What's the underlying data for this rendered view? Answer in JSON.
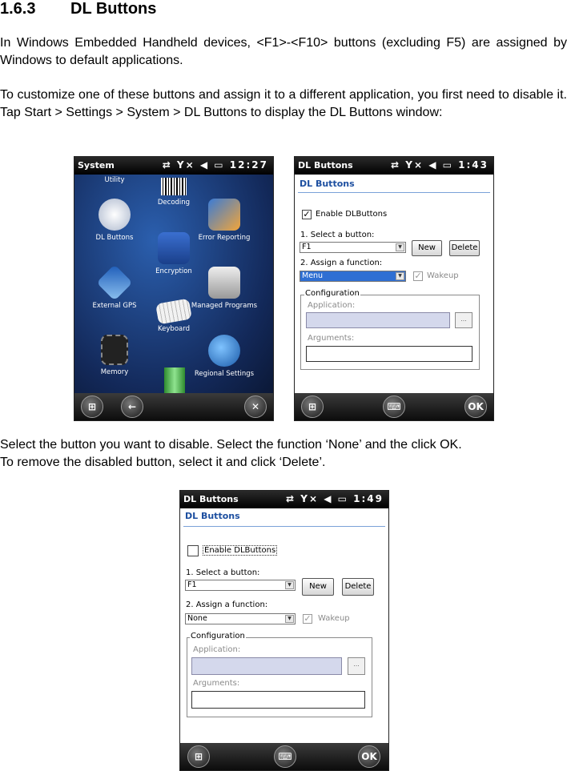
{
  "section": {
    "number": "1.6.3",
    "title": "DL Buttons"
  },
  "paragraphs": {
    "p1": "In Windows Embedded Handheld devices, <F1>-<F10> buttons (excluding F5) are assigned by Windows to default applications.",
    "p2": "To customize one of these buttons and assign it to a different application, you first need to disable it. Tap Start > Settings > System > DL Buttons to display the DL Buttons window:",
    "p3_line1": "Select the button you want to disable. Select the function ‘None’ and the click OK.",
    "p3_line2": "To remove the disabled button, select it and click ‘Delete’."
  },
  "screen_system": {
    "title": "System",
    "time": "12:27",
    "items": [
      "Utility",
      "Decoding",
      "DL Buttons",
      "Error Reporting",
      "Encryption",
      "External GPS",
      "Managed Programs",
      "Keyboard",
      "Memory",
      "Regional Settings"
    ]
  },
  "screen_dl_1": {
    "title": "DL Buttons",
    "time": "1:43",
    "heading": "DL Buttons",
    "enable_label": "Enable DLButtons",
    "enable_checked": true,
    "select_button_label": "1. Select a button:",
    "select_button_value": "F1",
    "new_label": "New",
    "delete_label": "Delete",
    "assign_label": "2. Assign a function:",
    "assign_value": "Menu",
    "wakeup_label": "Wakeup",
    "config_label": "Configuration",
    "application_label": "Application:",
    "ellipsis": "...",
    "arguments_label": "Arguments:"
  },
  "screen_dl_2": {
    "title": "DL Buttons",
    "time": "1:49",
    "heading": "DL Buttons",
    "enable_label": "Enable DLButtons",
    "enable_checked": false,
    "select_button_label": "1. Select a button:",
    "select_button_value": "F1",
    "new_label": "New",
    "delete_label": "Delete",
    "assign_label": "2. Assign a function:",
    "assign_value": "None",
    "wakeup_label": "Wakeup",
    "config_label": "Configuration",
    "application_label": "Application:",
    "ellipsis": "...",
    "arguments_label": "Arguments:",
    "ok_label": "OK"
  },
  "softkeys": {
    "ok": "OK"
  },
  "status_icons": "⇄ Y⨯ ◀ ▭",
  "colors": {
    "accent": "#1d4fa0",
    "highlight": "#2f6fd3",
    "disabled_field": "#d4d8ec"
  }
}
